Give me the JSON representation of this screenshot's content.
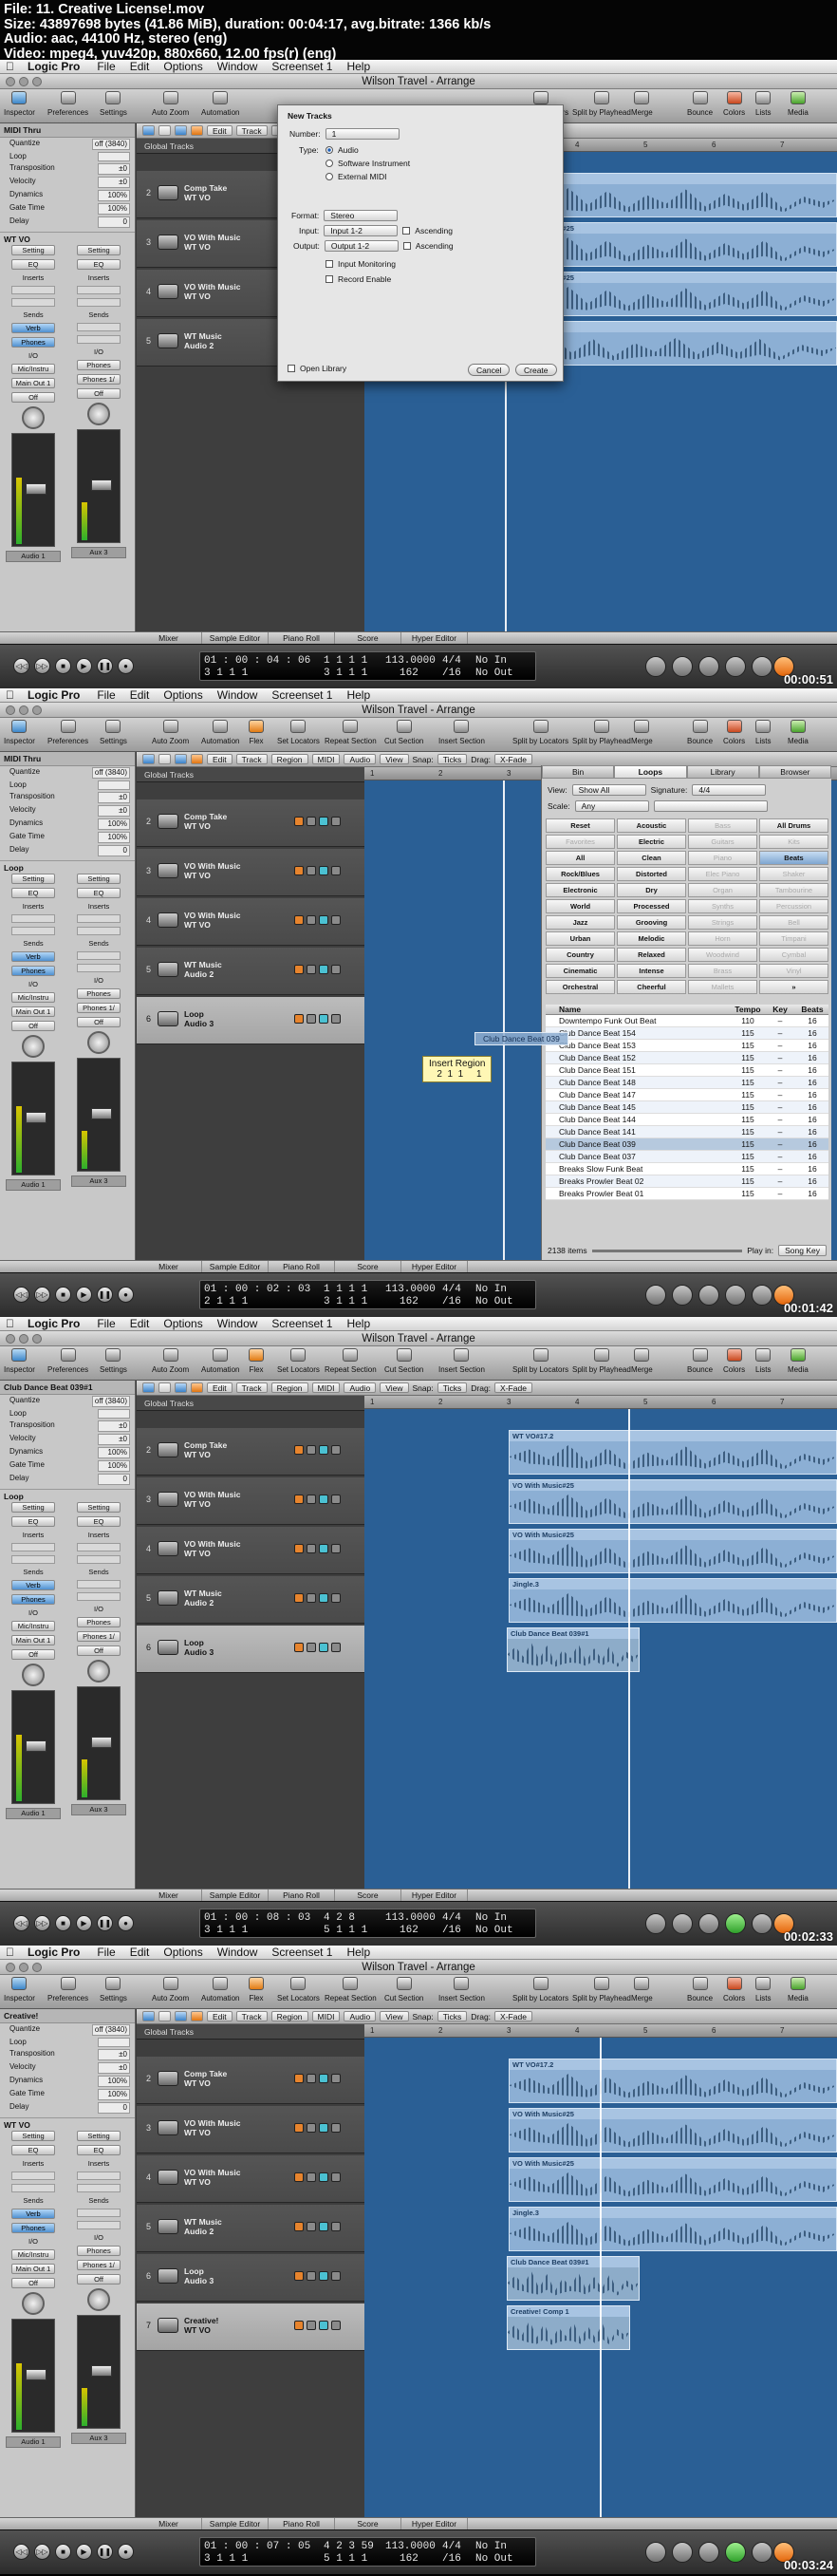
{
  "info": {
    "lines": [
      "File: 11. Creative License!.mov",
      "Size: 43897698 bytes (41.86 MiB), duration: 00:04:17, avg.bitrate: 1366 kb/s",
      "Audio: aac, 44100 Hz, stereo (eng)",
      "Video: mpeg4, yuv420p, 880x660, 12.00 fps(r) (eng)"
    ]
  },
  "menubar": {
    "app": "Logic Pro",
    "items": [
      "File",
      "Edit",
      "Options",
      "Window",
      "Screenset 1",
      "Help"
    ]
  },
  "window_title": "Wilson Travel - Arrange",
  "toolbar": {
    "items": [
      "Inspector",
      "Preferences",
      "Settings",
      "Auto Zoom",
      "Automation",
      "Flex",
      "Set Locators",
      "Repeat Section",
      "Cut Section",
      "Insert Section",
      "Split by Locators",
      "Split by Playhead",
      "Merge",
      "Bounce",
      "Colors",
      "Lists",
      "Media"
    ]
  },
  "bottom_tabs": [
    "Mixer",
    "Sample Editor",
    "Piano Roll",
    "Score",
    "Hyper Editor"
  ],
  "area_menus": [
    "Edit",
    "Track",
    "Region",
    "MIDI",
    "Audio",
    "View"
  ],
  "snap": {
    "label": "Snap:",
    "value": "Ticks",
    "drag_label": "Drag:",
    "drag_value": "X-Fade"
  },
  "global_tracks": "Global Tracks",
  "inspector_params": [
    [
      "Quantize",
      "off (3840)"
    ],
    [
      "Loop",
      ""
    ],
    [
      "Transposition",
      "±0"
    ],
    [
      "Velocity",
      "±0"
    ],
    [
      "Dynamics",
      "100%"
    ],
    [
      "Gate Time",
      "100%"
    ],
    [
      "Delay",
      "0"
    ]
  ],
  "strips": {
    "left": {
      "setting": "Setting",
      "eq": "EQ",
      "inserts": "Inserts",
      "sends": "Sends",
      "send1": "Verb",
      "send2": "Phones",
      "io": "I/O",
      "input": "Mic/Instru",
      "output": "Main Out 1",
      "auto": "Off",
      "name": "Audio 1"
    },
    "right": {
      "setting": "Setting",
      "eq": "EQ",
      "inserts": "Inserts",
      "sends": "Sends",
      "io": "I/O",
      "input": "Phones",
      "output": "Phones 1/",
      "auto": "Off",
      "name": "Aux 3"
    }
  },
  "frames": [
    {
      "region_header": "MIDI Thru",
      "section": "WT VO",
      "tracks": [
        {
          "num": "2",
          "name": "Comp Take",
          "sub": "WT VO"
        },
        {
          "num": "3",
          "name": "VO With Music",
          "sub": "WT VO"
        },
        {
          "num": "4",
          "name": "VO With Music",
          "sub": "WT VO"
        },
        {
          "num": "5",
          "name": "WT Music",
          "sub": "Audio 2"
        }
      ],
      "regions": [
        "WT VO#17.2",
        "VO With Music#25",
        "VO With Music#25",
        "Jingle.3"
      ],
      "dialog": {
        "title": "New Tracks",
        "number_label": "Number:",
        "number": "1",
        "type_label": "Type:",
        "types": [
          "Audio",
          "Software Instrument",
          "External MIDI"
        ],
        "format_label": "Format:",
        "format": "Stereo",
        "input_label": "Input:",
        "input": "Input 1-2",
        "output_label": "Output:",
        "output": "Output 1-2",
        "ascending": "Ascending",
        "monitoring": "Input Monitoring",
        "record_enable": "Record Enable",
        "open_library": "Open Library",
        "cancel": "Cancel",
        "create": "Create"
      },
      "lcd": {
        "time": "01 : 00 : 04 : 06",
        "time2": "3  1  1  1",
        "bars": "1  1  1  1",
        "bars2": "3  1  1  1",
        "tempo": "113.0000",
        "sig": "4/4",
        "sig2": "/16",
        "division": "162",
        "in": "No In",
        "out": "No Out"
      },
      "timecode": "00:00:51"
    },
    {
      "region_header": "MIDI Thru",
      "section": "Loop",
      "tracks": [
        {
          "num": "2",
          "name": "Comp Take",
          "sub": "WT VO"
        },
        {
          "num": "3",
          "name": "VO With Music",
          "sub": "WT VO"
        },
        {
          "num": "4",
          "name": "VO With Music",
          "sub": "WT VO"
        },
        {
          "num": "5",
          "name": "WT Music",
          "sub": "Audio 2"
        },
        {
          "num": "6",
          "name": "Loop",
          "sub": "Audio 3"
        }
      ],
      "library": {
        "tabs": [
          "Bin",
          "Loops",
          "Library",
          "Browser"
        ],
        "view_label": "View:",
        "view_value": "Show All",
        "sig_label": "Signature:",
        "sig_value": "4/4",
        "scale_label": "Scale:",
        "scale_value": "Any",
        "keywords": [
          [
            "Reset",
            "Acoustic",
            "Bass",
            "All Drums"
          ],
          [
            "Favorites",
            "Electric",
            "Guitars",
            "Kits"
          ],
          [
            "All",
            "Clean",
            "Piano",
            "Beats"
          ],
          [
            "Rock/Blues",
            "Distorted",
            "Elec Piano",
            "Shaker"
          ],
          [
            "Electronic",
            "Dry",
            "Organ",
            "Tambourine"
          ],
          [
            "World",
            "Processed",
            "Synths",
            "Percussion"
          ],
          [
            "Jazz",
            "Grooving",
            "Strings",
            "Bell"
          ],
          [
            "Urban",
            "Melodic",
            "Horn",
            "Timpani"
          ],
          [
            "Country",
            "Relaxed",
            "Woodwind",
            "Cymbal"
          ],
          [
            "Cinematic",
            "Intense",
            "Brass",
            "Vinyl"
          ],
          [
            "Orchestral",
            "Cheerful",
            "Mallets",
            "»"
          ]
        ],
        "columns": [
          "Name",
          "Tempo",
          "Key",
          "Beats"
        ],
        "rows": [
          [
            "Downtempo Funk Out Beat",
            "110",
            "–",
            "16"
          ],
          [
            "Club Dance Beat 154",
            "115",
            "–",
            "16"
          ],
          [
            "Club Dance Beat 153",
            "115",
            "–",
            "16"
          ],
          [
            "Club Dance Beat 152",
            "115",
            "–",
            "16"
          ],
          [
            "Club Dance Beat 151",
            "115",
            "–",
            "16"
          ],
          [
            "Club Dance Beat 148",
            "115",
            "–",
            "16"
          ],
          [
            "Club Dance Beat 147",
            "115",
            "–",
            "16"
          ],
          [
            "Club Dance Beat 145",
            "115",
            "–",
            "16"
          ],
          [
            "Club Dance Beat 144",
            "115",
            "–",
            "16"
          ],
          [
            "Club Dance Beat 141",
            "115",
            "–",
            "16"
          ],
          [
            "Club Dance Beat 039",
            "115",
            "–",
            "16"
          ],
          [
            "Club Dance Beat 037",
            "115",
            "–",
            "16"
          ],
          [
            "Breaks Slow Funk Beat",
            "115",
            "–",
            "16"
          ],
          [
            "Breaks Prowler Beat 02",
            "115",
            "–",
            "16"
          ],
          [
            "Breaks Prowler Beat 01",
            "115",
            "–",
            "16"
          ]
        ],
        "count": "2138 items",
        "playin_label": "Play in:",
        "playin_value": "Song Key"
      },
      "drag_label": "Club Dance Beat 039",
      "tooltip": "Insert Region\n   2  1  1     1",
      "lcd": {
        "time": "01 : 00 : 02 : 03",
        "time2": "2  1  1  1",
        "bars": "1  1  1  1",
        "bars2": "3  1  1  1",
        "tempo": "113.0000",
        "sig": "4/4",
        "sig2": "/16",
        "division": "162",
        "in": "No In",
        "out": "No Out"
      },
      "timecode": "00:01:42"
    },
    {
      "region_header": "Club Dance Beat 039#1",
      "section": "Loop",
      "tracks": [
        {
          "num": "2",
          "name": "Comp Take",
          "sub": "WT VO"
        },
        {
          "num": "3",
          "name": "VO With Music",
          "sub": "WT VO"
        },
        {
          "num": "4",
          "name": "VO With Music",
          "sub": "WT VO"
        },
        {
          "num": "5",
          "name": "WT Music",
          "sub": "Audio 2"
        },
        {
          "num": "6",
          "name": "Loop",
          "sub": "Audio 3"
        }
      ],
      "regions": [
        "WT VO#17.2",
        "VO With Music#25",
        "VO With Music#25",
        "Jingle.3",
        "Club Dance Beat 039#1"
      ],
      "lcd": {
        "time": "01 : 00 : 08 : 03",
        "time2": "3  1  1  1",
        "bars": "4  2  8",
        "bars2": "5  1  1  1",
        "tempo": "113.0000",
        "sig": "4/4",
        "sig2": "/16",
        "division": "162",
        "in": "No In",
        "out": "No Out"
      },
      "timecode": "00:02:33"
    },
    {
      "region_header": "Creative!",
      "section": "WT VO",
      "tracks": [
        {
          "num": "2",
          "name": "Comp Take",
          "sub": "WT VO"
        },
        {
          "num": "3",
          "name": "VO With Music",
          "sub": "WT VO"
        },
        {
          "num": "4",
          "name": "VO With Music",
          "sub": "WT VO"
        },
        {
          "num": "5",
          "name": "WT Music",
          "sub": "Audio 2"
        },
        {
          "num": "6",
          "name": "Loop",
          "sub": "Audio 3"
        },
        {
          "num": "7",
          "name": "Creative!",
          "sub": "WT VO"
        }
      ],
      "regions": [
        "WT VO#17.2",
        "VO With Music#25",
        "VO With Music#25",
        "Jingle.3",
        "Club Dance Beat 039#1",
        "Creative! Comp 1"
      ],
      "lcd": {
        "time": "01 : 00 : 07 : 05",
        "time2": "3  1  1  1",
        "bars": "4  2  3  59",
        "bars2": "5  1  1  1",
        "tempo": "113.0000",
        "sig": "4/4",
        "sig2": "/16",
        "division": "162",
        "in": "No In",
        "out": "No Out"
      },
      "timecode": "00:03:24"
    }
  ]
}
